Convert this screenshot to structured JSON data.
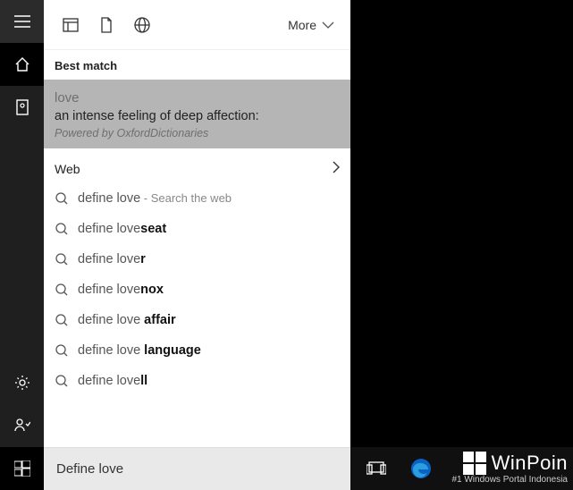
{
  "sidebar": {
    "items": [
      "hamburger",
      "home",
      "collections",
      "settings",
      "feedback",
      "start"
    ]
  },
  "toolbar": {
    "more_label": "More"
  },
  "sections": {
    "best_label": "Best match",
    "web_label": "Web"
  },
  "best_match": {
    "word": "love",
    "definition": "an intense feeling of deep affection:",
    "source": "Powered by OxfordDictionaries"
  },
  "suggestions": [
    {
      "base": "define love",
      "bold": "",
      "hint": " - Search the web"
    },
    {
      "base": "define love",
      "bold": "seat",
      "hint": ""
    },
    {
      "base": "define love",
      "bold": "r",
      "hint": ""
    },
    {
      "base": "define love",
      "bold": "nox",
      "hint": ""
    },
    {
      "base": "define love ",
      "bold": "affair",
      "hint": ""
    },
    {
      "base": "define love ",
      "bold": "language",
      "hint": ""
    },
    {
      "base": "define love",
      "bold": "ll",
      "hint": ""
    }
  ],
  "search": {
    "value": "Define love"
  },
  "watermark": {
    "name": "WinPoin",
    "tagline": "#1 Windows Portal Indonesia"
  }
}
